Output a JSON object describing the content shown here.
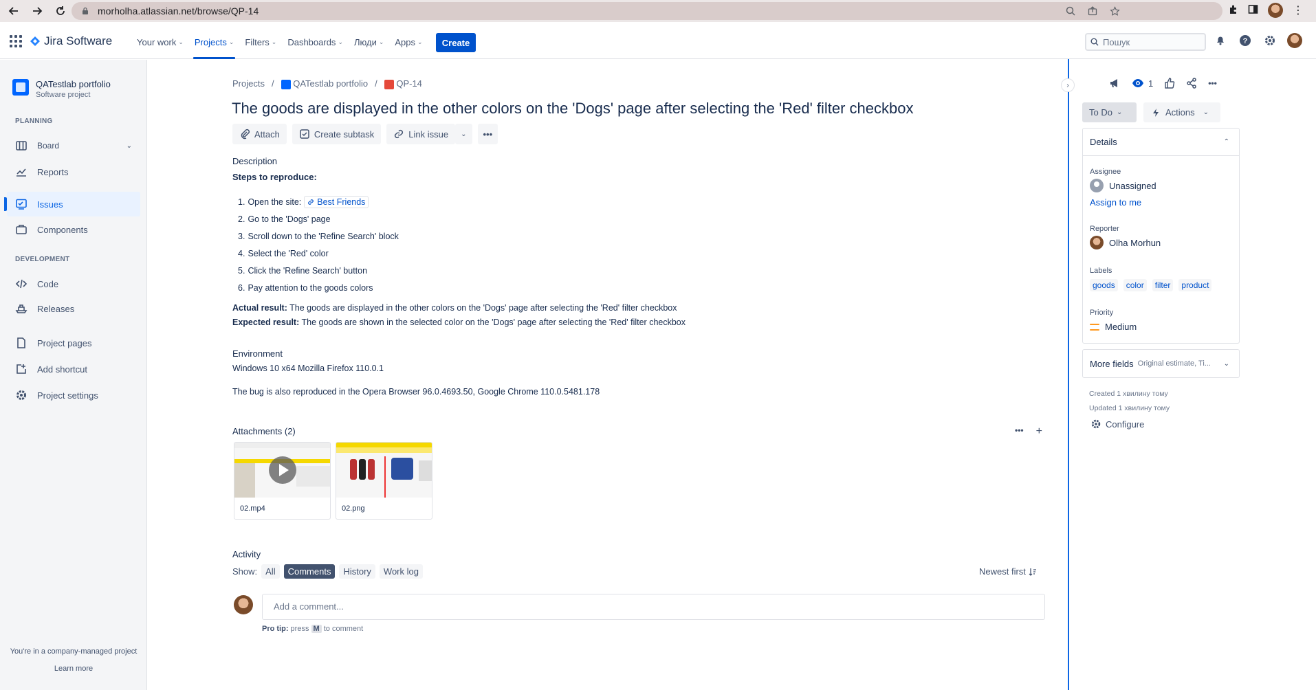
{
  "browser": {
    "url": "morholha.atlassian.net/browse/QP-14"
  },
  "topnav": {
    "app_name": "Jira Software",
    "menu": [
      {
        "label": "Your work"
      },
      {
        "label": "Projects"
      },
      {
        "label": "Filters"
      },
      {
        "label": "Dashboards"
      },
      {
        "label": "Люди"
      },
      {
        "label": "Apps"
      }
    ],
    "create_label": "Create",
    "search_placeholder": "Пошук"
  },
  "sidebar": {
    "project_name": "QATestlab portfolio",
    "project_type": "Software project",
    "planning_label": "PLANNING",
    "development_label": "DEVELOPMENT",
    "items": {
      "board": "Board",
      "reports": "Reports",
      "issues": "Issues",
      "components": "Components",
      "code": "Code",
      "releases": "Releases",
      "project_pages": "Project pages",
      "add_shortcut": "Add shortcut",
      "project_settings": "Project settings"
    },
    "footer_text": "You're in a company-managed project",
    "footer_link": "Learn more"
  },
  "breadcrumbs": {
    "projects": "Projects",
    "project": "QATestlab portfolio",
    "issue_key": "QP-14",
    "separator": "/"
  },
  "issue": {
    "title": "The goods are displayed in the other colors on the 'Dogs' page after selecting the 'Red' filter checkbox",
    "toolbar": {
      "attach": "Attach",
      "create_subtask": "Create subtask",
      "link_issue": "Link issue"
    },
    "description_label": "Description",
    "steps_heading": "Steps to reproduce:",
    "steps": [
      {
        "num": "1.",
        "text": "Open the site:",
        "link": "Best Friends"
      },
      {
        "num": "2.",
        "text": "Go to the 'Dogs' page"
      },
      {
        "num": "3.",
        "text": "Scroll down to the 'Refine Search' block"
      },
      {
        "num": "4.",
        "text": "Select the 'Red' color"
      },
      {
        "num": "5.",
        "text": "Click the 'Refine Search' button"
      },
      {
        "num": "6.",
        "text": "Pay attention to the goods colors"
      }
    ],
    "actual_label": "Actual result:",
    "actual_text": " The goods are displayed in the other colors on the 'Dogs' page after selecting the 'Red' filter checkbox",
    "expected_label": "Expected result:",
    "expected_text": " The goods are shown in the selected color on the 'Dogs' page after selecting the 'Red' filter checkbox",
    "environment_label": "Environment",
    "environment_value": "Windows 10 x64  Mozilla Firefox 110.0.1",
    "environment_note": "The bug is also reproduced in the Opera Browser 96.0.4693.50, Google Chrome 110.0.5481.178",
    "attachments_label": "Attachments (2)",
    "attachments": [
      {
        "name": "02.mp4"
      },
      {
        "name": "02.png"
      }
    ],
    "activity_label": "Activity",
    "show_label": "Show:",
    "activity_filters": [
      "All",
      "Comments",
      "History",
      "Work log"
    ],
    "active_filter": "Comments",
    "sort_label": "Newest first",
    "comment_placeholder": "Add a comment...",
    "protip_prefix": "Pro tip:",
    "protip_press": " press ",
    "protip_key": "M",
    "protip_suffix": " to comment"
  },
  "right_panel": {
    "watchers_count": "1",
    "status": "To Do",
    "actions": "Actions",
    "details_label": "Details",
    "assignee_label": "Assignee",
    "assignee_value": "Unassigned",
    "assign_to_me": "Assign to me",
    "reporter_label": "Reporter",
    "reporter_value": "Olha Morhun",
    "labels_label": "Labels",
    "labels": [
      "goods",
      "color",
      "filter",
      "product"
    ],
    "priority_label": "Priority",
    "priority_value": "Medium",
    "more_fields": "More fields",
    "more_fields_sub": "Original estimate, Ti...",
    "created": "Created 1 хвилину тому",
    "updated": "Updated 1 хвилину тому",
    "configure": "Configure"
  },
  "colors": {
    "brand_blue": "#0052cc",
    "sidebar_bg": "#f4f5f7",
    "priority_medium": "#ff991f",
    "bug_red": "#e5493a"
  }
}
